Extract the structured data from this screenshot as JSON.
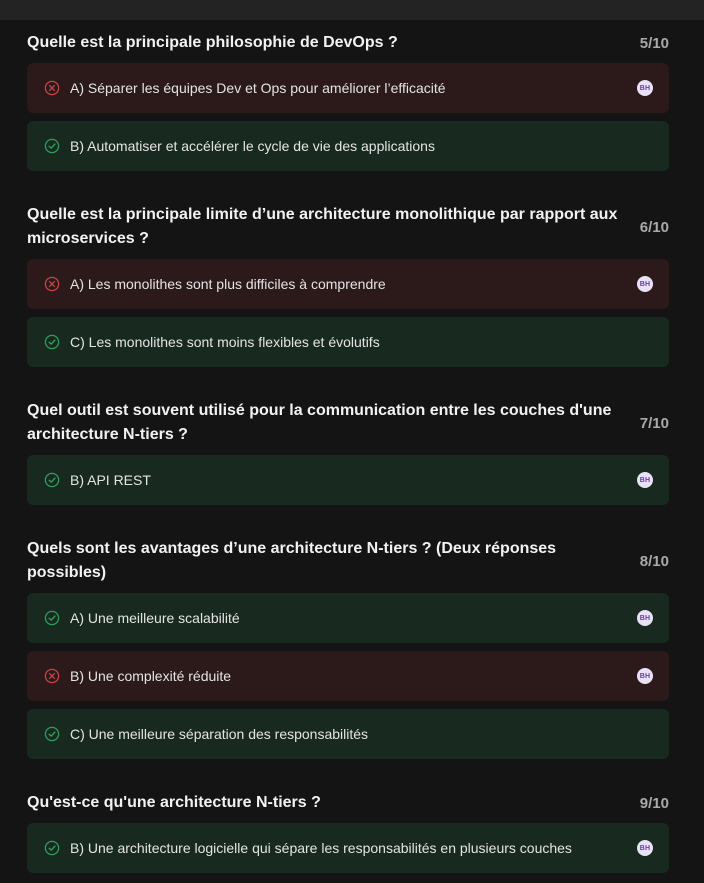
{
  "questions": [
    {
      "title": "Quelle est la principale philosophie de DevOps ?",
      "score": "5/10",
      "answers": [
        {
          "text": "A) Séparer les équipes Dev et Ops pour améliorer l’efficacité",
          "status": "wrong",
          "avatar": "BH"
        },
        {
          "text": "B) Automatiser et accélérer le cycle de vie des applications",
          "status": "correct",
          "avatar": ""
        }
      ]
    },
    {
      "title": "Quelle est la principale limite d’une architecture monolithique par rapport aux microservices ?",
      "score": "6/10",
      "answers": [
        {
          "text": "A) Les monolithes sont plus difficiles à comprendre",
          "status": "wrong",
          "avatar": "BH"
        },
        {
          "text": "C) Les monolithes sont moins flexibles et évolutifs",
          "status": "correct",
          "avatar": ""
        }
      ]
    },
    {
      "title": "Quel outil est souvent utilisé pour la communication entre les couches d'une architecture N-tiers ?",
      "score": "7/10",
      "answers": [
        {
          "text": "B) API REST",
          "status": "correct",
          "avatar": "BH"
        }
      ]
    },
    {
      "title": "Quels sont les avantages d’une architecture N-tiers ? (Deux réponses possibles)",
      "score": "8/10",
      "answers": [
        {
          "text": "A) Une meilleure scalabilité",
          "status": "correct",
          "avatar": "BH"
        },
        {
          "text": "B) Une complexité réduite",
          "status": "wrong",
          "avatar": "BH"
        },
        {
          "text": "C) Une meilleure séparation des responsabilités",
          "status": "correct",
          "avatar": ""
        }
      ]
    },
    {
      "title": "Qu'est-ce qu'une architecture N-tiers ?",
      "score": "9/10",
      "answers": [
        {
          "text": "B) Une architecture logicielle qui sépare les responsabilités en plusieurs couches",
          "status": "correct",
          "avatar": "BH"
        }
      ]
    }
  ],
  "colors": {
    "correct": "#2e9e5b",
    "wrong": "#c9434a",
    "avatar_bg": "#e9e1f6",
    "avatar_text": "#6a3aa8"
  }
}
